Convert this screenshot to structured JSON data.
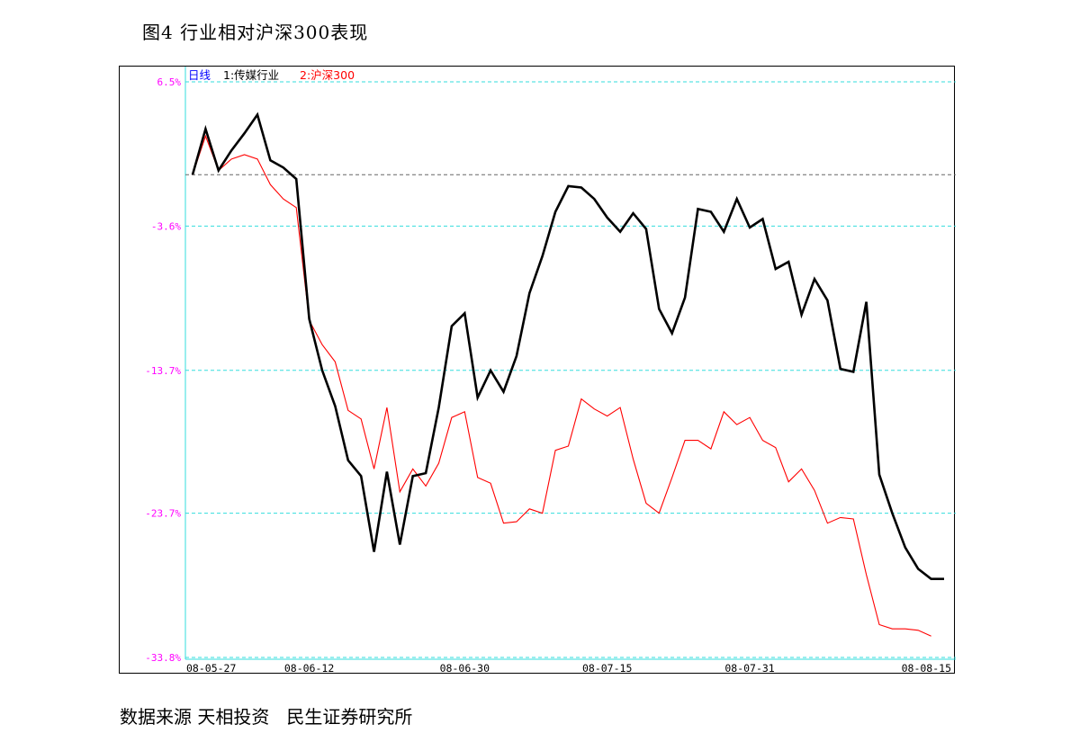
{
  "figure": {
    "title": "图4   行业相对沪深300表现",
    "source": "数据来源 天相投资   民生证券研究所"
  },
  "legend": {
    "period": "日线",
    "s1_label": "1:传媒行业",
    "s2_label": "2:沪深300"
  },
  "colors": {
    "series1": "#000000",
    "series2": "#ff0000",
    "grid": "#33dddd",
    "ytick": "#ff00ff",
    "xtick": "#000000",
    "baseline": "#666666",
    "period_label": "#0000ff"
  },
  "chart_data": {
    "type": "line",
    "title": "行业相对沪深300表现",
    "xlabel": "",
    "ylabel": "",
    "ylim": [
      -33.8,
      6.5
    ],
    "yticks": [
      "6.5%",
      "-3.6%",
      "-13.7%",
      "-23.7%",
      "-33.8%"
    ],
    "ytick_values": [
      6.5,
      -3.6,
      -13.7,
      -23.7,
      -33.8
    ],
    "xticks": [
      "08-05-27",
      "08-06-12",
      "08-06-30",
      "08-07-15",
      "08-07-31",
      "08-08-15"
    ],
    "xtick_index": [
      0,
      9,
      21,
      32,
      43,
      55
    ],
    "baseline": 0,
    "grid": true,
    "legend_position": "top-left",
    "series": [
      {
        "name": "1:传媒行业",
        "values": [
          0,
          3.2,
          0.3,
          1.7,
          2.9,
          4.2,
          1.0,
          0.5,
          -0.3,
          -10.1,
          -13.7,
          -16.2,
          -20.0,
          -21.1,
          -26.4,
          -20.8,
          -25.9,
          -21.1,
          -20.9,
          -16.3,
          -10.6,
          -9.7,
          -15.6,
          -13.7,
          -15.2,
          -12.7,
          -8.3,
          -5.7,
          -2.6,
          -0.8,
          -0.9,
          -1.7,
          -3.0,
          -4.0,
          -2.7,
          -3.8,
          -9.4,
          -11.1,
          -8.6,
          -2.4,
          -2.6,
          -4.0,
          -1.7,
          -3.7,
          -3.1,
          -6.6,
          -6.1,
          -9.8,
          -7.3,
          -8.8,
          -13.6,
          -13.8,
          -8.9,
          -21.0,
          -23.7,
          -26.1,
          -27.6,
          -28.3,
          -28.3
        ]
      },
      {
        "name": "2:沪深300",
        "values": [
          0,
          2.7,
          0.3,
          1.1,
          1.4,
          1.1,
          -0.7,
          -1.7,
          -2.3,
          -10.2,
          -11.9,
          -13.1,
          -16.5,
          -17.1,
          -20.6,
          -16.3,
          -22.2,
          -20.6,
          -21.8,
          -20.2,
          -17.0,
          -16.6,
          -21.2,
          -21.6,
          -24.4,
          -24.3,
          -23.4,
          -23.7,
          -19.3,
          -19.0,
          -15.7,
          -16.4,
          -16.9,
          -16.3,
          -19.9,
          -23.0,
          -23.7,
          -21.2,
          -18.6,
          -18.6,
          -19.2,
          -16.6,
          -17.5,
          -17.0,
          -18.6,
          -19.1,
          -21.5,
          -20.6,
          -22.1,
          -24.4,
          -24.0,
          -24.1,
          -28.0,
          -31.5,
          -31.8,
          -31.8,
          -31.9,
          -32.3
        ]
      }
    ]
  }
}
